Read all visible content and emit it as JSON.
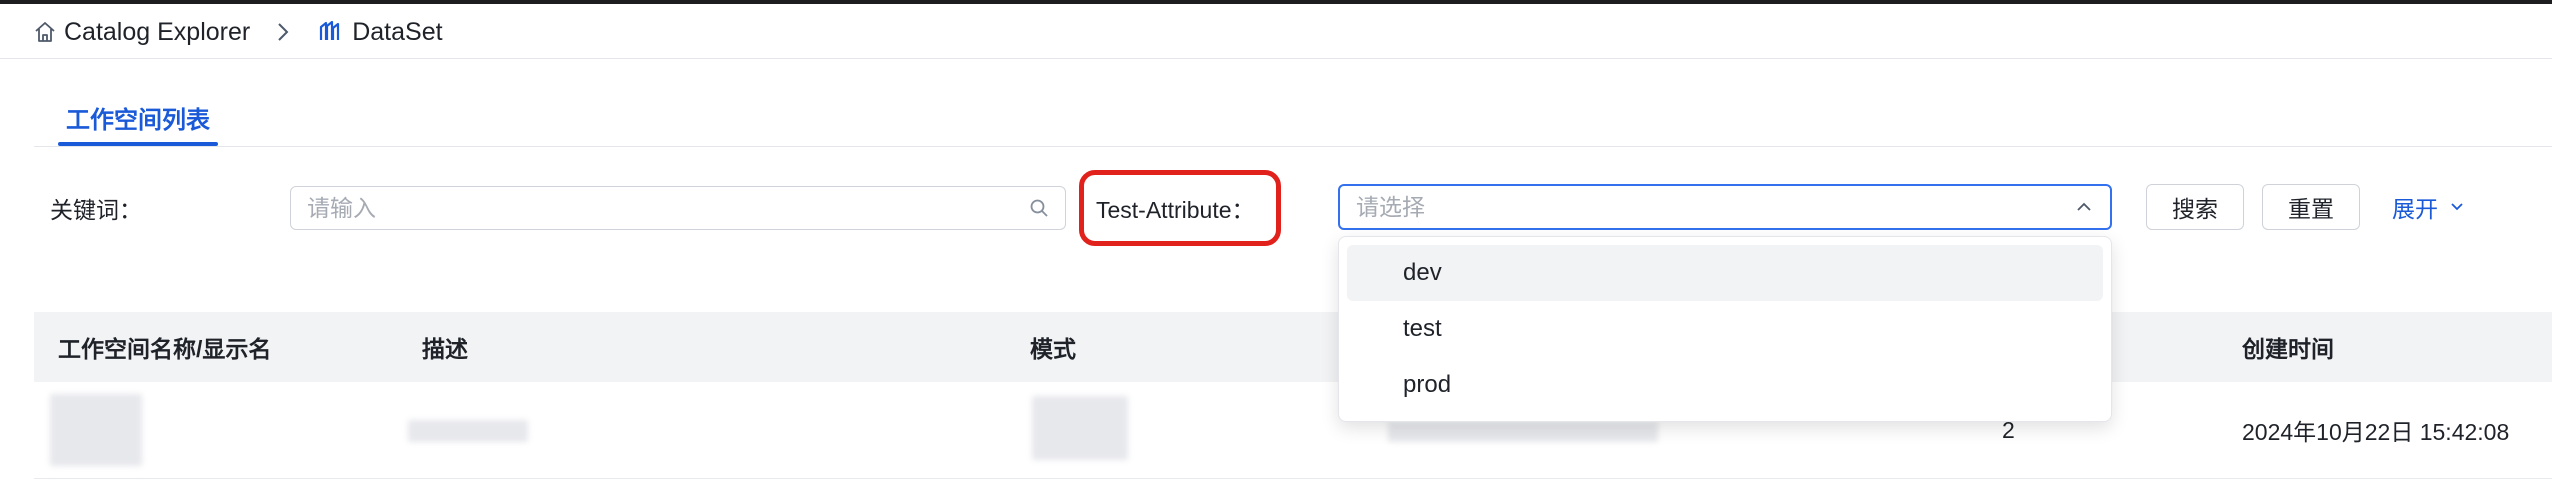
{
  "breadcrumb": {
    "home_label": "Catalog Explorer",
    "current_label": "DataSet",
    "home_icon": "home-icon",
    "separator_icon": "chevron-right-icon",
    "dataset_icon": "dataset-icon"
  },
  "tabs": [
    {
      "label": "工作空间列表",
      "active": true
    }
  ],
  "filters": {
    "keyword_label": "关键词：",
    "keyword_placeholder": "请输入",
    "keyword_value": "",
    "attribute_label": "Test-Attribute：",
    "attribute_placeholder": "请选择",
    "attribute_value": "",
    "search_button": "搜索",
    "reset_button": "重置",
    "expand_label": "展开"
  },
  "dropdown": {
    "options": [
      {
        "label": "dev",
        "highlighted": true
      },
      {
        "label": "test",
        "highlighted": false
      },
      {
        "label": "prod",
        "highlighted": false
      }
    ]
  },
  "table": {
    "columns": [
      "工作空间名称/显示名",
      "描述",
      "模式",
      "",
      "",
      "创建时间"
    ],
    "rows": [
      {
        "count": "2",
        "created_at": "2024年10月22日 15:42:08"
      }
    ]
  },
  "colors": {
    "accent": "#1a5ad8",
    "highlight_red": "#e0211c",
    "header_bg": "#f2f3f5"
  }
}
